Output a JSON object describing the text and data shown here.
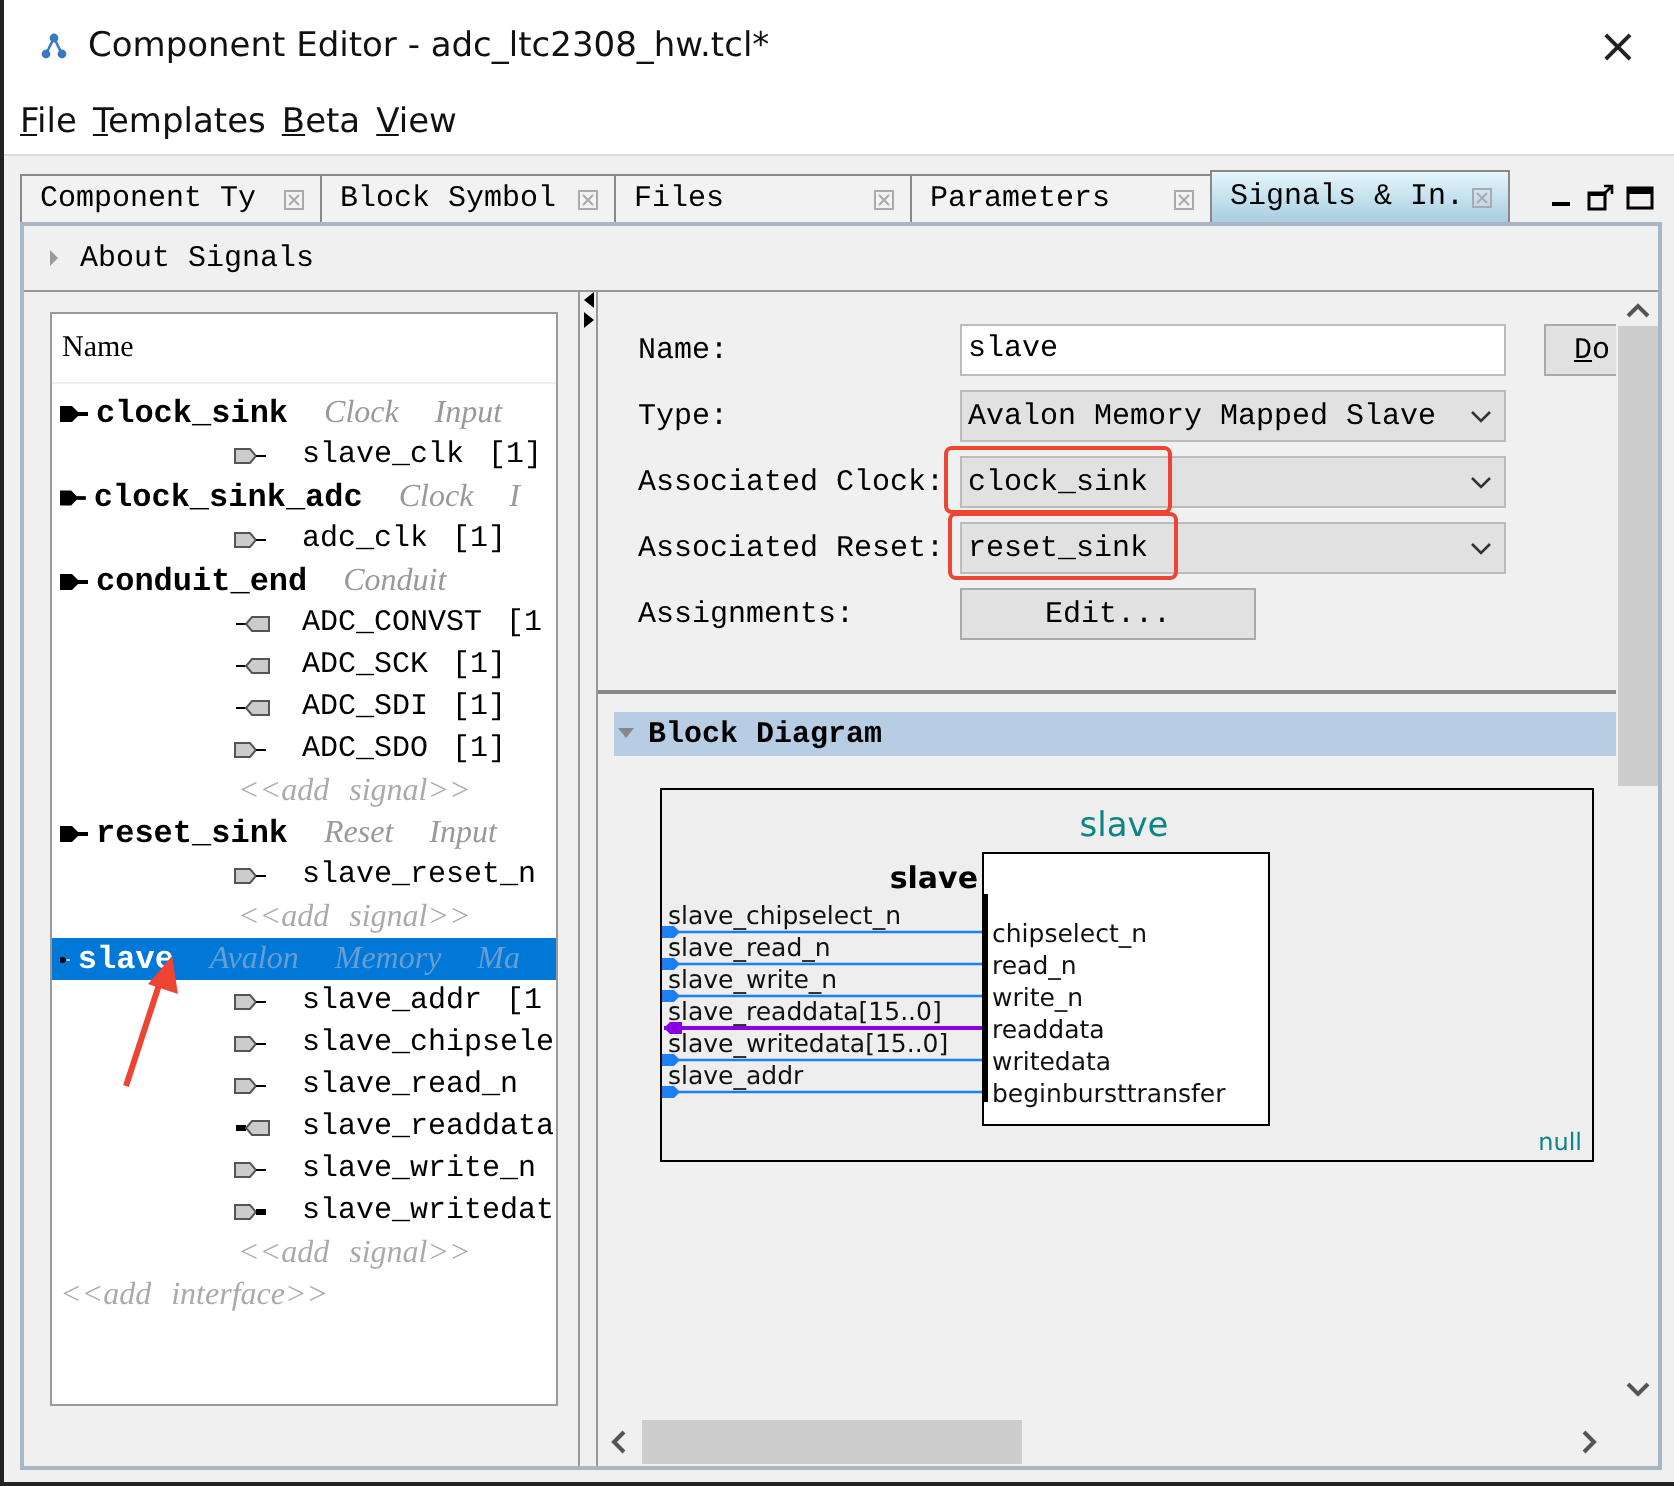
{
  "window": {
    "title": "Component Editor - adc_ltc2308_hw.tcl*",
    "close": "×"
  },
  "menu": [
    "File",
    "Templates",
    "Beta",
    "View"
  ],
  "tabs": [
    {
      "label": "Component Ty",
      "selected": false
    },
    {
      "label": "Block Symbol",
      "selected": false
    },
    {
      "label": "Files",
      "selected": false
    },
    {
      "label": "Parameters",
      "selected": false
    },
    {
      "label": "Signals & In.",
      "selected": true
    }
  ],
  "about": {
    "label": "About Signals",
    "expanded": false
  },
  "tree": {
    "header": "Name",
    "interfaces": [
      {
        "name": "clock_sink",
        "type": [
          "Clock",
          "Input"
        ],
        "selected": false,
        "signals": [
          {
            "name": "slave_clk",
            "width": "[1]",
            "kind": "input",
            "bus": false
          }
        ]
      },
      {
        "name": "clock_sink_adc",
        "type": [
          "Clock",
          "I"
        ],
        "selected": false,
        "signals": [
          {
            "name": "adc_clk",
            "width": "[1]",
            "kind": "input",
            "bus": false
          }
        ]
      },
      {
        "name": "conduit_end",
        "type": [
          "Conduit"
        ],
        "selected": false,
        "signals": [
          {
            "name": "ADC_CONVST",
            "width": "[1",
            "kind": "output",
            "bus": false
          },
          {
            "name": "ADC_SCK",
            "width": "[1]",
            "kind": "output",
            "bus": false
          },
          {
            "name": "ADC_SDI",
            "width": "[1]",
            "kind": "output",
            "bus": false
          },
          {
            "name": "ADC_SDO",
            "width": "[1]",
            "kind": "input",
            "bus": false
          }
        ],
        "add_signal": "<<add signal>>"
      },
      {
        "name": "reset_sink",
        "type": [
          "Reset",
          "Input"
        ],
        "selected": false,
        "signals": [
          {
            "name": "slave_reset_n",
            "kind": "input",
            "bus": false
          }
        ],
        "add_signal": "<<add signal>>"
      },
      {
        "name": "slave",
        "type": [
          "Avalon",
          "Memory",
          "Ma"
        ],
        "selected": true,
        "signals": [
          {
            "name": "slave_addr",
            "width": "[1",
            "kind": "input",
            "bus": false
          },
          {
            "name": "slave_chipsele",
            "kind": "input",
            "bus": false
          },
          {
            "name": "slave_read_n",
            "kind": "input",
            "bus": false
          },
          {
            "name": "slave_readdata",
            "kind": "output",
            "bus": true
          },
          {
            "name": "slave_write_n",
            "kind": "input",
            "bus": false
          },
          {
            "name": "slave_writedat",
            "kind": "input",
            "bus": true
          }
        ],
        "add_signal": "<<add signal>>"
      }
    ],
    "add_interface": "<<add interface>>"
  },
  "form": [
    {
      "label": "Name:",
      "kind": "text",
      "value": "slave",
      "highlighted": false,
      "side_button": "Do"
    },
    {
      "label": "Type:",
      "kind": "select",
      "value": "Avalon Memory Mapped Slave",
      "highlighted": false
    },
    {
      "label": "Associated Clock:",
      "kind": "select",
      "value": "clock_sink",
      "highlighted": true
    },
    {
      "label": "Associated Reset:",
      "kind": "select",
      "value": "reset_sink",
      "highlighted": true
    },
    {
      "label": "Assignments:",
      "kind": "button",
      "value": "Edit...",
      "highlighted": false
    }
  ],
  "block_diagram": {
    "title": "Block Diagram",
    "expanded": true,
    "component": "slave",
    "interface": "slave",
    "signals": [
      {
        "label": "slave_chipselect_n",
        "port": "chipselect_n",
        "kind": "input"
      },
      {
        "label": "slave_read_n",
        "port": "read_n",
        "kind": "input"
      },
      {
        "label": "slave_write_n",
        "port": "write_n",
        "kind": "input"
      },
      {
        "label": "slave_readdata[15..0]",
        "port": "readdata",
        "kind": "output"
      },
      {
        "label": "slave_writedata[15..0]",
        "port": "writedata",
        "kind": "input"
      },
      {
        "label": "slave_addr",
        "port": "beginbursttransfer",
        "kind": "input"
      }
    ],
    "footer": "null"
  }
}
